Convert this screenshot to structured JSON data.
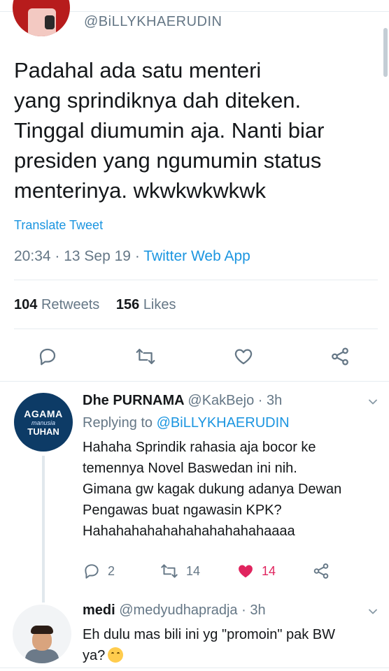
{
  "tweet": {
    "author_handle": "@BiLLYKHAERUDIN",
    "text": "Padahal ada satu menteri\nyang sprindiknya dah diteken.\nTinggal diumumin aja. Nanti biar\npresiden yang ngumumin status\nmenterinya. wkwkwkwkwk",
    "translate_label": "Translate Tweet",
    "time": "20:34",
    "date": "13 Sep 19",
    "source": "Twitter Web App",
    "retweets_count": "104",
    "retweets_label": "Retweets",
    "likes_count": "156",
    "likes_label": "Likes"
  },
  "replies": [
    {
      "display_name": "Dhe PURNAMA",
      "handle": "@KakBejo",
      "age": "3h",
      "replying_prefix": "Replying to",
      "replying_to": "@BiLLYKHAERUDIN",
      "text": "Hahaha Sprindik rahasia aja bocor ke\ntemennya Novel Baswedan ini nih.\nGimana gw kagak dukung adanya Dewan\nPengawas buat ngawasin KPK?\nHahahahahahahahahahahahaaaa",
      "avatar_text": [
        "AGAMA",
        "manusia",
        "TUHAN"
      ],
      "reply_count": "2",
      "retweet_count": "14",
      "like_count": "14",
      "liked": true
    },
    {
      "display_name": "medi",
      "handle": "@medyudhapradja",
      "age": "3h",
      "text": "Eh dulu mas bili ini yg \"promoin\" pak BW\nya?"
    }
  ],
  "colors": {
    "accent": "#1b95e0",
    "muted": "#657786",
    "like": "#e0245e"
  }
}
